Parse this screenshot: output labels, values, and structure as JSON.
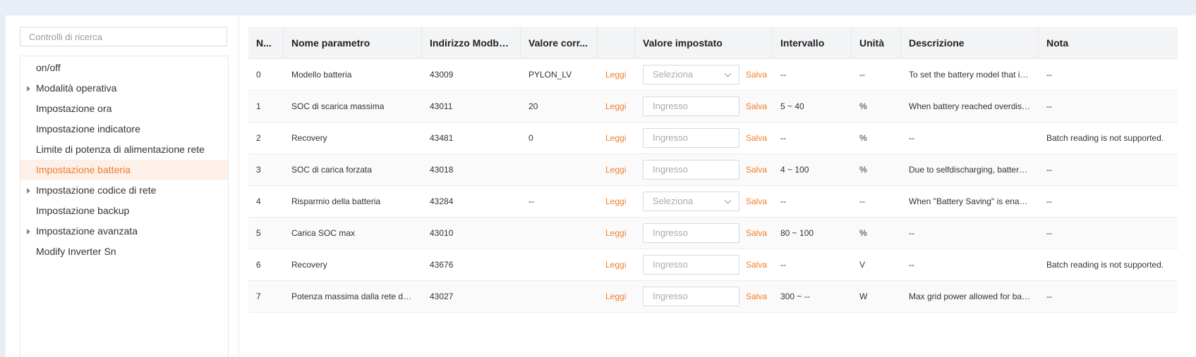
{
  "search": {
    "placeholder": "Controlli di ricerca"
  },
  "tree": [
    {
      "label": "on/off",
      "expandable": false,
      "active": false
    },
    {
      "label": "Modalità operativa",
      "expandable": true,
      "active": false
    },
    {
      "label": "Impostazione ora",
      "expandable": false,
      "active": false
    },
    {
      "label": "Impostazione indicatore",
      "expandable": false,
      "active": false
    },
    {
      "label": "Limite di potenza di alimentazione rete",
      "expandable": false,
      "active": false
    },
    {
      "label": "Impostazione batteria",
      "expandable": false,
      "active": true
    },
    {
      "label": "Impostazione codice di rete",
      "expandable": true,
      "active": false
    },
    {
      "label": "Impostazione backup",
      "expandable": false,
      "active": false
    },
    {
      "label": "Impostazione avanzata",
      "expandable": true,
      "active": false
    },
    {
      "label": "Modify Inverter Sn",
      "expandable": false,
      "active": false
    }
  ],
  "colors": {
    "accent": "#f07d2c",
    "active_bg": "#fdf0e8",
    "header_bg": "#f3f4f6"
  },
  "table": {
    "headers": {
      "num": "N...",
      "name": "Nome parametro",
      "addr": "Indirizzo Modbu...",
      "curr": "Valore corr...",
      "action": "",
      "set": "Valore impostato",
      "range": "Intervallo",
      "unit": "Unità",
      "desc": "Descrizione",
      "note": "Nota"
    },
    "read_label": "Leggi",
    "save_label": "Salva",
    "select_placeholder": "Seleziona",
    "input_placeholder": "Ingresso",
    "rows": [
      {
        "num": "0",
        "name": "Modello batteria",
        "addr": "43009",
        "curr": "PYLON_LV",
        "control": "select",
        "range": "--",
        "unit": "--",
        "desc": "To set the battery model that is...",
        "note": "--"
      },
      {
        "num": "1",
        "name": "SOC di scarica massima",
        "addr": "43011",
        "curr": "20",
        "control": "input",
        "range": "5 ~ 40",
        "unit": "%",
        "desc": "When battery reached overdisc...",
        "note": "--"
      },
      {
        "num": "2",
        "name": "Recovery",
        "addr": "43481",
        "curr": "0",
        "control": "input",
        "range": "--",
        "unit": "%",
        "desc": "--",
        "note": "Batch reading is not supported."
      },
      {
        "num": "3",
        "name": "SOC di carica forzata",
        "addr": "43018",
        "curr": "",
        "control": "input",
        "range": "4 ~ 100",
        "unit": "%",
        "desc": "Due to selfdischarging, battery ...",
        "note": "--"
      },
      {
        "num": "4",
        "name": "Risparmio della batteria",
        "addr": "43284",
        "curr": "--",
        "control": "select",
        "range": "--",
        "unit": "--",
        "desc": "When \"Battery Saving\" is enabl...",
        "note": "--"
      },
      {
        "num": "5",
        "name": "Carica SOC max",
        "addr": "43010",
        "curr": "",
        "control": "input",
        "range": "80 ~ 100",
        "unit": "%",
        "desc": "--",
        "note": "--"
      },
      {
        "num": "6",
        "name": "Recovery",
        "addr": "43676",
        "curr": "",
        "control": "input",
        "range": "--",
        "unit": "V",
        "desc": "--",
        "note": "Batch reading is not supported."
      },
      {
        "num": "7",
        "name": "Potenza massima dalla rete dur...",
        "addr": "43027",
        "curr": "",
        "control": "input",
        "range": "300 ~ --",
        "unit": "W",
        "desc": "Max grid power allowed for bat...",
        "note": "--"
      }
    ]
  }
}
